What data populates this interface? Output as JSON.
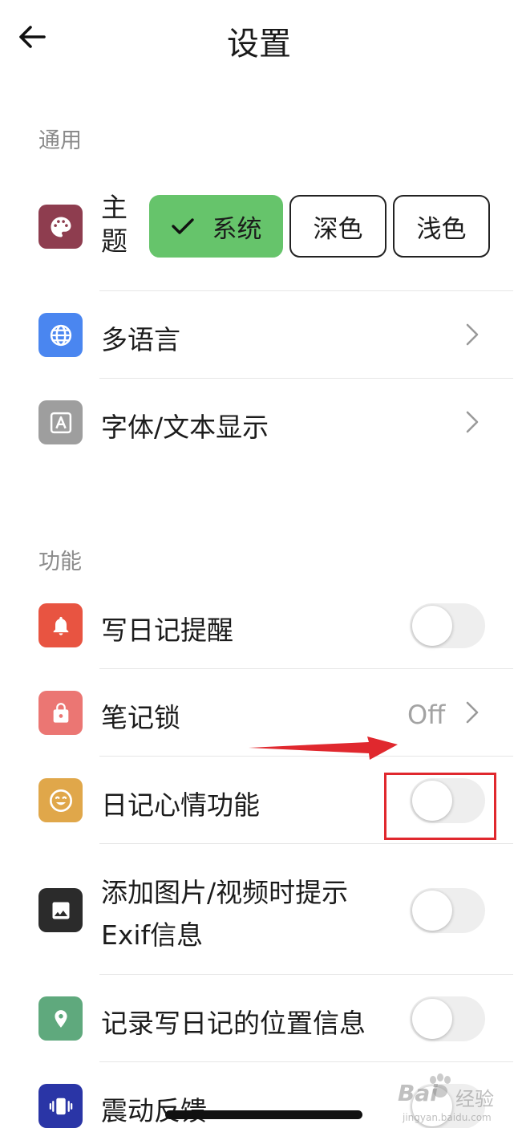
{
  "header": {
    "title": "设置",
    "back_icon": "arrow-left-icon"
  },
  "sections": {
    "general": {
      "title": "通用",
      "theme": {
        "label": "主题",
        "options": [
          "系统",
          "深色",
          "浅色"
        ],
        "selected": "系统",
        "icon": "palette-icon",
        "icon_color": "#8e3d4f"
      },
      "language": {
        "label": "多语言",
        "icon": "globe-icon",
        "icon_color": "#4a86f0"
      },
      "font": {
        "label": "字体/文本显示",
        "icon": "font-a-icon",
        "icon_color": "#9e9e9e"
      }
    },
    "features": {
      "title": "功能",
      "reminder": {
        "label": "写日记提醒",
        "icon": "bell-icon",
        "icon_color": "#e85441",
        "on": false
      },
      "note_lock": {
        "label": "笔记锁",
        "icon": "lock-icon",
        "icon_color": "#eb7673",
        "value": "Off"
      },
      "mood": {
        "label": "日记心情功能",
        "icon": "smile-icon",
        "icon_color": "#e0a74a",
        "on": false
      },
      "exif": {
        "label": "添加图片/视频时提示Exif信息",
        "icon": "image-icon",
        "icon_color": "#2b2b2b",
        "on": false
      },
      "location": {
        "label": "记录写日记的位置信息",
        "icon": "location-pin-icon",
        "icon_color": "#5fa97d",
        "on": false
      },
      "vibration": {
        "label": "震动反馈",
        "icon": "vibration-icon",
        "icon_color": "#2a35a6",
        "on": false
      }
    }
  },
  "colors": {
    "selected_theme": "#66c46b",
    "annotation": "#e0282e",
    "section_title": "#8a8a8a"
  },
  "watermark": {
    "brand": "Bai",
    "brand_cn": "经验",
    "url": "jingyan.baidu.com"
  }
}
